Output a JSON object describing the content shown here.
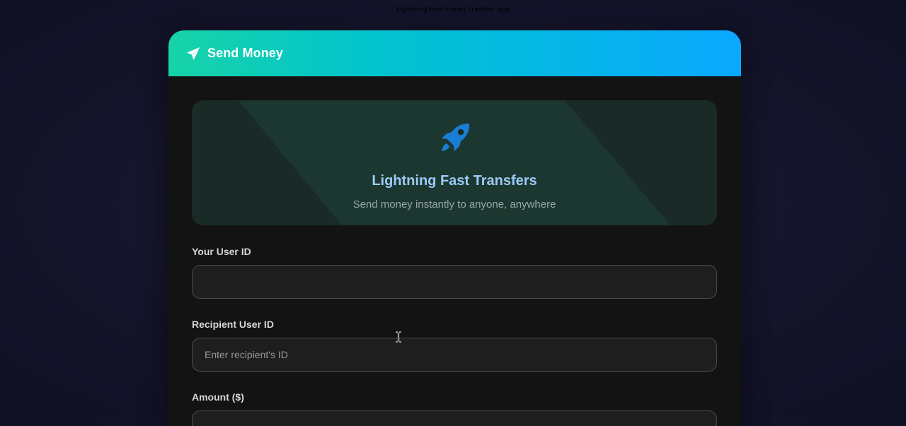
{
  "browser": {
    "caption": "Lightning fast money transfer app"
  },
  "header": {
    "title": "Send Money",
    "icon": "paper-plane-icon"
  },
  "hero": {
    "icon": "rocket-icon",
    "title": "Lightning Fast Transfers",
    "subtitle": "Send money instantly to anyone, anywhere"
  },
  "form": {
    "user_id": {
      "label": "Your User ID",
      "value": "",
      "placeholder": ""
    },
    "recipient_id": {
      "label": "Recipient User ID",
      "value": "",
      "placeholder": "Enter recipient's ID"
    },
    "amount": {
      "label": "Amount ($)",
      "value": "",
      "placeholder": ""
    }
  },
  "colors": {
    "header_gradient_start": "#17d3a8",
    "header_gradient_end": "#0aa8ff",
    "hero_title": "#9ccbf7",
    "rocket": "#1a7fd4",
    "card_background": "#131313"
  }
}
